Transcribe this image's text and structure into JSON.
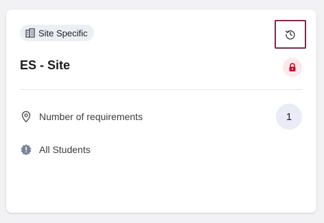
{
  "card": {
    "chip_label": "Site Specific",
    "title": "ES - Site",
    "requirements_label": "Number of requirements",
    "requirements_count": "1",
    "audience_label": "All Students"
  },
  "icons": {
    "chip": "building-icon",
    "history": "history-icon",
    "lock": "lock-icon",
    "location": "location-pin-icon",
    "audience": "alert-badge-icon"
  },
  "colors": {
    "history_border": "#7a2a4e",
    "lock": "#c8102e",
    "lock_bg": "#fde8ea",
    "count_bg": "#ebebf7"
  }
}
